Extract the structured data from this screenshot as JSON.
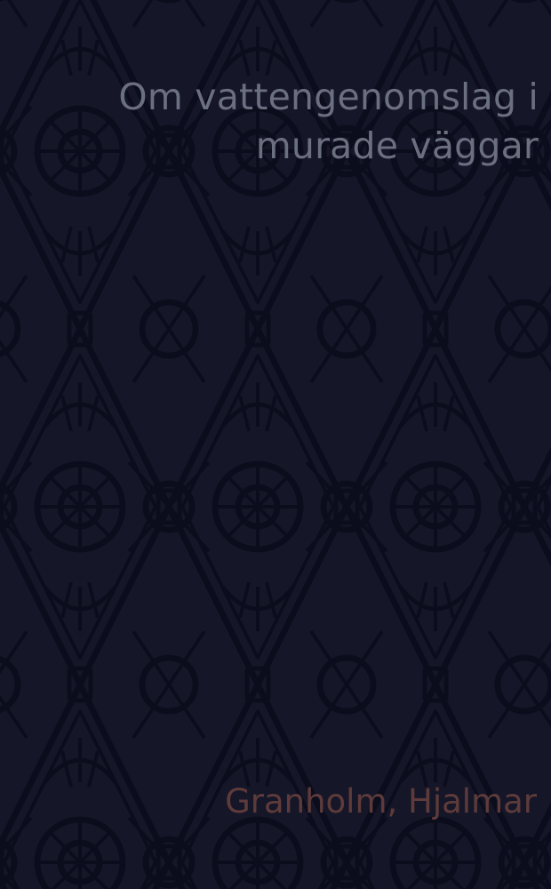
{
  "book": {
    "title": "Om vattengenomslag i murade väggar",
    "author": "Granholm, Hjalmar"
  },
  "colors": {
    "background": "#151628",
    "pattern": "#0c0d1c",
    "title": "#6b7081",
    "author": "#5e3b3a"
  },
  "decoration": "gothic-tracery-pattern"
}
